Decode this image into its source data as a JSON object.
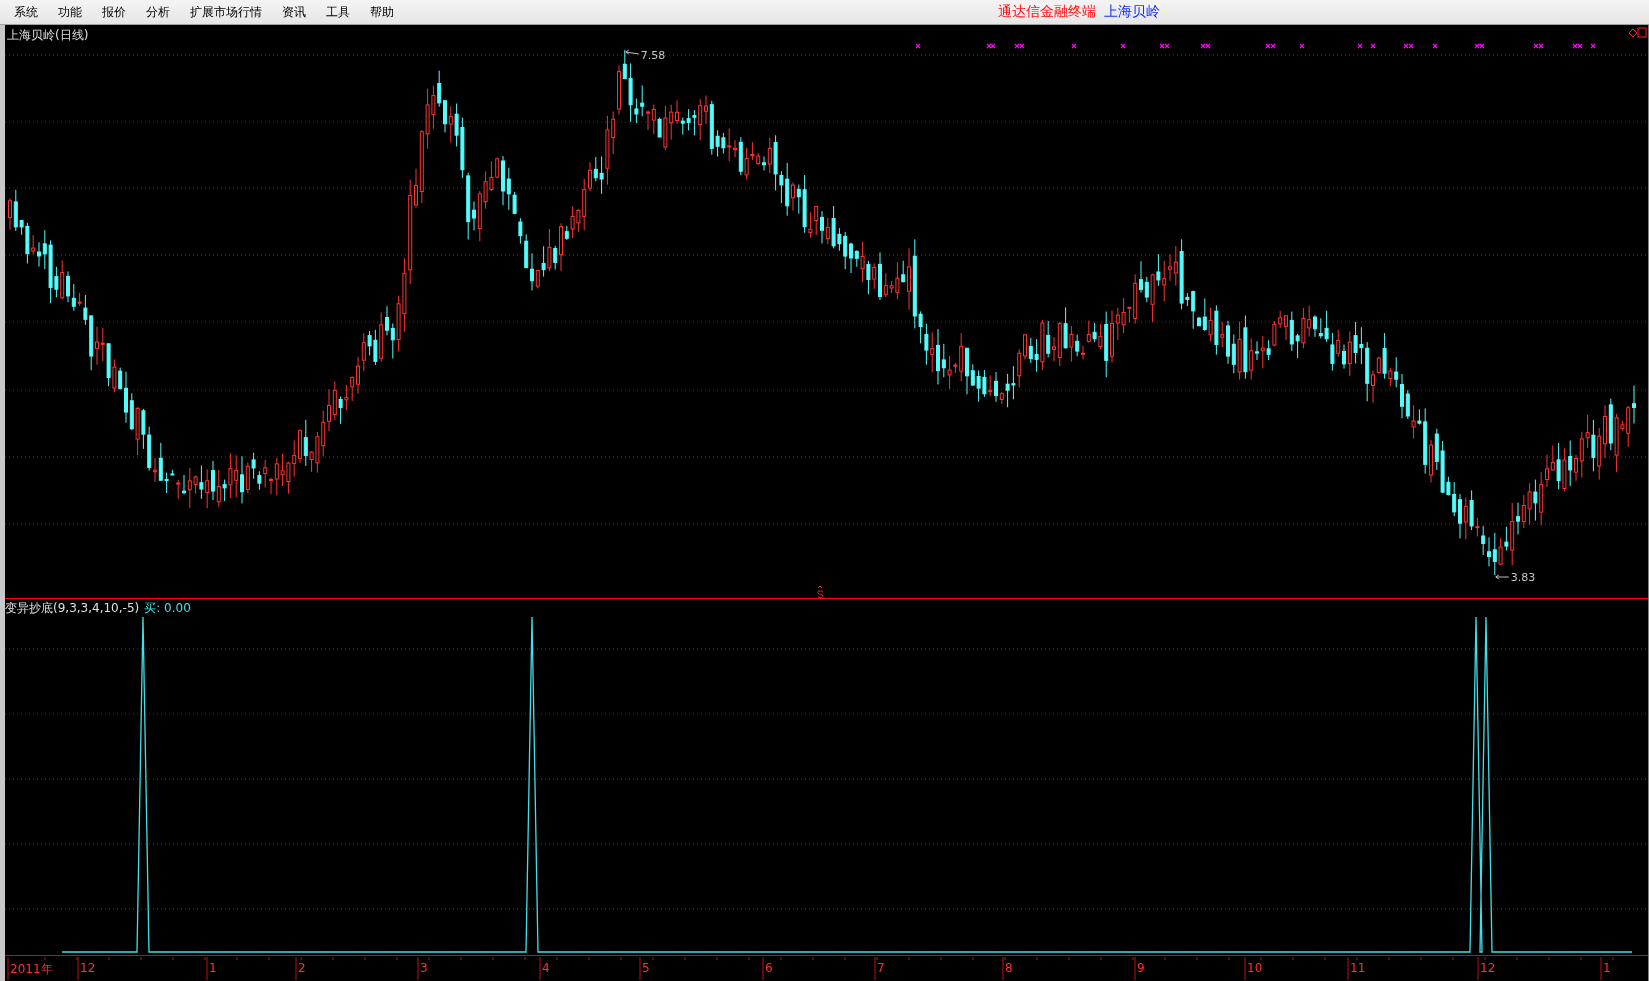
{
  "menu": [
    "系统",
    "功能",
    "报价",
    "分析",
    "扩展市场行情",
    "资讯",
    "工具",
    "帮助"
  ],
  "app_title": "通达信金融终端",
  "stock_title": "上海贝岭",
  "main_panel": {
    "label": "上海贝岭(日线)",
    "high_label": "7.58",
    "low_label": "3.83"
  },
  "indicator_panel": {
    "label": "变异抄底(9,3,3,4,10,-5)",
    "value": "买: 0.00"
  },
  "time_axis": [
    "2011年",
    "12",
    "1",
    "2",
    "3",
    "4",
    "5",
    "6",
    "7",
    "8",
    "9",
    "10",
    "11",
    "12",
    "1"
  ]
}
